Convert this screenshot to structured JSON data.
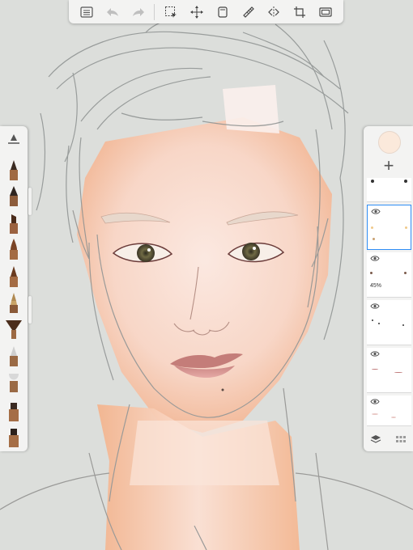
{
  "toolbar": {
    "buttons": [
      {
        "name": "list-icon"
      },
      {
        "name": "undo-icon"
      },
      {
        "name": "redo-icon"
      },
      {
        "name": "selection-icon"
      },
      {
        "name": "transform-icon"
      },
      {
        "name": "layer-copy-icon"
      },
      {
        "name": "ruler-icon"
      },
      {
        "name": "symmetry-icon"
      },
      {
        "name": "crop-icon"
      },
      {
        "name": "fullscreen-icon"
      }
    ]
  },
  "brushes": [
    {
      "name": "brush-size-slider-icon"
    },
    {
      "name": "pencil-brush-icon"
    },
    {
      "name": "ballpoint-brush-icon"
    },
    {
      "name": "marker-brush-icon"
    },
    {
      "name": "paintbrush-icon"
    },
    {
      "name": "airbrush-icon"
    },
    {
      "name": "ink-pen-icon"
    },
    {
      "name": "fan-brush-icon"
    },
    {
      "name": "smudge-brush-icon"
    },
    {
      "name": "soft-brush-icon"
    },
    {
      "name": "blender-brush-icon"
    },
    {
      "name": "eraser-icon"
    }
  ],
  "layers": {
    "current_color": "#fbe9db",
    "items": [
      {
        "id": "layer-1",
        "opacity": ""
      },
      {
        "id": "layer-2",
        "opacity": ""
      },
      {
        "id": "layer-3",
        "opacity": "45%"
      },
      {
        "id": "layer-4",
        "opacity": ""
      },
      {
        "id": "layer-5",
        "opacity": ""
      },
      {
        "id": "layer-6",
        "opacity": ""
      }
    ]
  },
  "colors": {
    "canvas_bg": "#dcdedb",
    "panel_bg": "#f3f3f2",
    "selection_accent": "#2e8df5",
    "skin": "#f6d2c0",
    "sketch_line": "#8d9190"
  }
}
